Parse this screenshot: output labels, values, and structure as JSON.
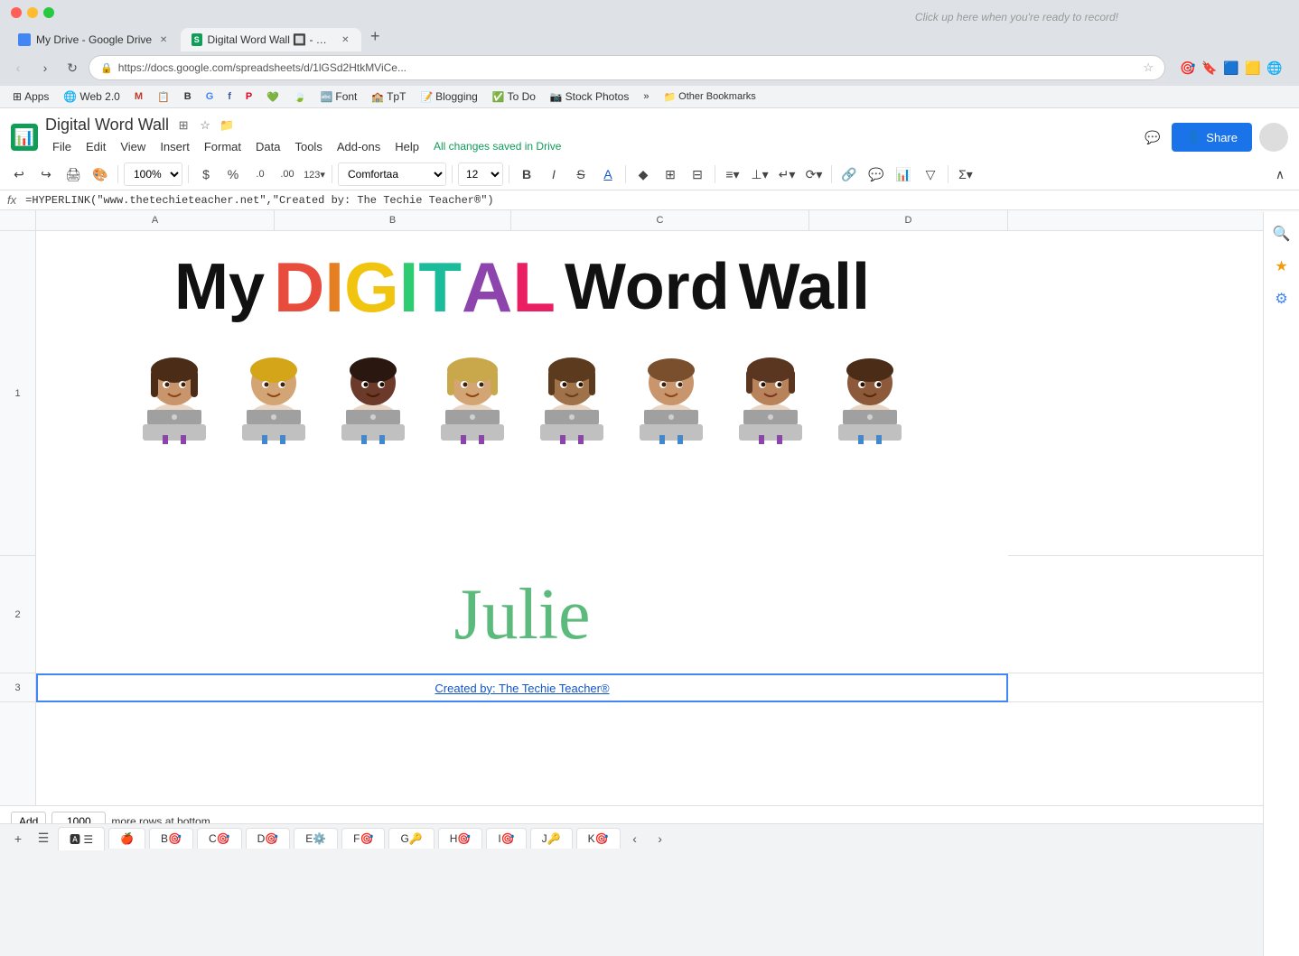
{
  "browser": {
    "tabs": [
      {
        "id": "drive",
        "label": "My Drive - Google Drive",
        "favicon": "drive",
        "active": false
      },
      {
        "id": "sheets",
        "label": "Digital Word Wall 🔲 - Google ...",
        "favicon": "sheets",
        "active": true
      }
    ],
    "new_tab_label": "+",
    "address": "https://docs.google.com/spreadsheets/d/1lGSd2HtkMViCe...",
    "recording_hint": "Click up here when you're ready to record!"
  },
  "bookmarks": [
    {
      "id": "apps",
      "label": "Apps"
    },
    {
      "id": "web20",
      "label": "Web 2.0"
    },
    {
      "id": "gmail",
      "label": ""
    },
    {
      "id": "bm",
      "label": ""
    },
    {
      "id": "b",
      "label": "B"
    },
    {
      "id": "google",
      "label": ""
    },
    {
      "id": "fb",
      "label": ""
    },
    {
      "id": "pinterest",
      "label": ""
    },
    {
      "id": "heart",
      "label": ""
    },
    {
      "id": "tpt",
      "label": ""
    },
    {
      "id": "font",
      "label": "Font"
    },
    {
      "id": "tptbm",
      "label": "TpT"
    },
    {
      "id": "blogging",
      "label": "Blogging"
    },
    {
      "id": "todo",
      "label": "To Do"
    },
    {
      "id": "photos",
      "label": "Stock Photos"
    }
  ],
  "sheets": {
    "title": "Digital Word Wall",
    "logo_letter": "S",
    "menu": [
      "File",
      "Edit",
      "View",
      "Insert",
      "Format",
      "Data",
      "Tools",
      "Add-ons",
      "Help"
    ],
    "status": "All changes saved in Drive",
    "share_btn": "Share",
    "toolbar": {
      "zoom": "100%",
      "currency": "$",
      "percent": "%",
      "decimal0": ".0",
      "decimal00": ".00",
      "more_formats": "123▾",
      "font": "Comfortaa",
      "font_size": "12",
      "bold": "B",
      "italic": "I",
      "strikethrough": "S̶",
      "text_color": "A",
      "fill_color": "◆",
      "borders": "⊞",
      "merge": "⊟"
    },
    "formula_bar": {
      "fx": "fx",
      "content": "=HYPERLINK(\"www.thetechieteacher.net\",\"Created by: The Techie Teacher®\")"
    },
    "columns": [
      "A",
      "B",
      "C",
      "D"
    ],
    "rows": [
      "1",
      "2",
      "3"
    ],
    "banner": {
      "title_my": "My",
      "title_digital": "DIGITAL",
      "title_word": "Word",
      "title_wall": "Wall",
      "kids": [
        "👧🏽💻",
        "👦🏼💻",
        "👦🏿💻",
        "👧🏼💻",
        "👧🏾💻",
        "👦🏽💻",
        "👧🏽💻",
        "👦🏾💻"
      ]
    },
    "student_name": "Julie",
    "link_text": "Created by: The Techie Teacher®",
    "add_rows": {
      "btn": "Add",
      "count": "1000",
      "label": "more rows at bottom."
    },
    "sheet_tabs": [
      "A☰",
      "A🍎",
      "B🎯",
      "C🎯",
      "D🎯",
      "E⚙️",
      "F🎯",
      "G🔑",
      "H🎯",
      "I🎯",
      "J🔑",
      "K🎯"
    ]
  }
}
